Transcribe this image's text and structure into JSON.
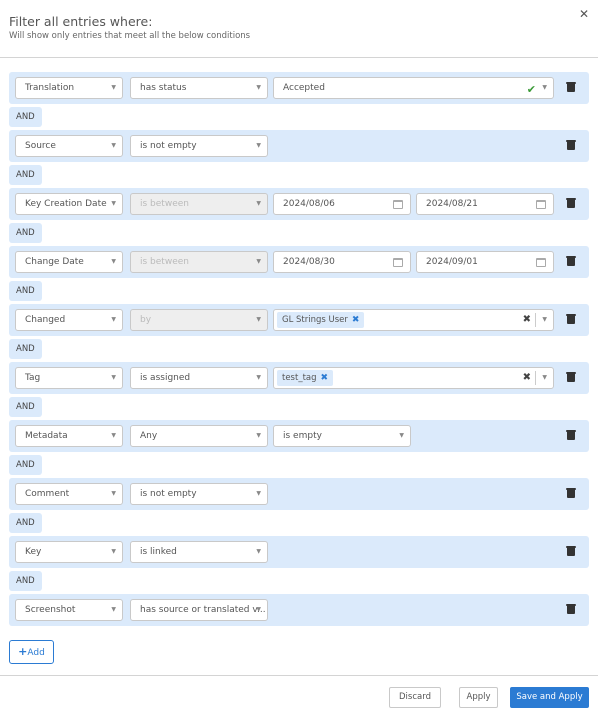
{
  "dialog": {
    "title": "Filter all entries where:",
    "subtitle": "Will show only entries that meet all the below conditions",
    "close_icon": "close-icon"
  },
  "connector_label": "AND",
  "conditions": [
    {
      "field": "Translation",
      "operator": "has status",
      "value": "Accepted",
      "value_type": "select-valid"
    },
    {
      "field": "Source",
      "operator": "is not empty",
      "value_type": "none"
    },
    {
      "field": "Key Creation Date",
      "operator": "is between",
      "operator_disabled": true,
      "date_from": "2024/08/06",
      "date_to": "2024/08/21",
      "value_type": "date-range"
    },
    {
      "field": "Change Date",
      "operator": "is between",
      "operator_disabled": true,
      "date_from": "2024/08/30",
      "date_to": "2024/09/01",
      "value_type": "date-range"
    },
    {
      "field": "Changed",
      "operator": "by",
      "operator_disabled": true,
      "tags": [
        "GL Strings User"
      ],
      "value_type": "multi-select"
    },
    {
      "field": "Tag",
      "operator": "is assigned",
      "tags": [
        "test_tag"
      ],
      "value_type": "multi-select"
    },
    {
      "field": "Metadata",
      "operator": "Any",
      "value": "is empty",
      "value_type": "select-short"
    },
    {
      "field": "Comment",
      "operator": "is not empty",
      "value_type": "none"
    },
    {
      "field": "Key",
      "operator": "is linked",
      "value_type": "none"
    },
    {
      "field": "Screenshot",
      "operator": "has source or translated v...",
      "value_type": "none"
    }
  ],
  "add_button": {
    "label": "Add",
    "icon": "plus-icon"
  },
  "footer": {
    "discard": "Discard",
    "apply": "Apply",
    "save_apply": "Save and Apply"
  },
  "colors": {
    "accent": "#2b7bd3",
    "row_bg": "#dbeafb",
    "valid_check": "#3a9a36"
  }
}
